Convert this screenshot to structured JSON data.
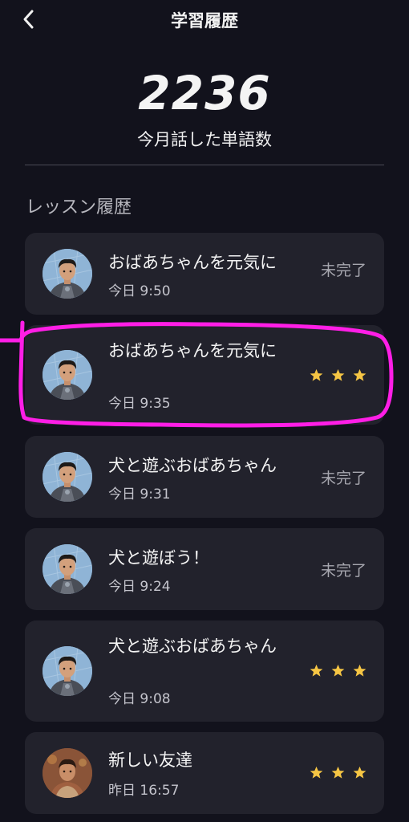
{
  "header": {
    "title": "学習履歴",
    "back_icon": "chevron-left-icon"
  },
  "stats": {
    "word_count": "2236",
    "word_count_label": "今月話した単語数"
  },
  "section": {
    "title": "レッスン履歴"
  },
  "lessons": [
    {
      "title": "おばあちゃんを元気に",
      "time": "今日 9:50",
      "status": "未完了",
      "rating": 0,
      "avatar": "robot-suit-avatar"
    },
    {
      "title": "おばあちゃんを元気に",
      "time": "今日 9:35",
      "status": "",
      "rating": 3,
      "avatar": "robot-suit-avatar"
    },
    {
      "title": "犬と遊ぶおばあちゃん",
      "time": "今日 9:31",
      "status": "未完了",
      "rating": 0,
      "avatar": "robot-suit-avatar"
    },
    {
      "title": "犬と遊ぼう！",
      "time": "今日 9:24",
      "status": "未完了",
      "rating": 0,
      "avatar": "robot-suit-avatar"
    },
    {
      "title": "犬と遊ぶおばあちゃん",
      "time": "今日 9:08",
      "status": "",
      "rating": 3,
      "avatar": "robot-suit-avatar"
    },
    {
      "title": "新しい友達",
      "time": "昨日 16:57",
      "status": "",
      "rating": 3,
      "avatar": "boy-avatar"
    }
  ],
  "colors": {
    "background": "#12121c",
    "card": "#22222c",
    "star": "#f5c544",
    "highlight": "#ff1ee6"
  }
}
